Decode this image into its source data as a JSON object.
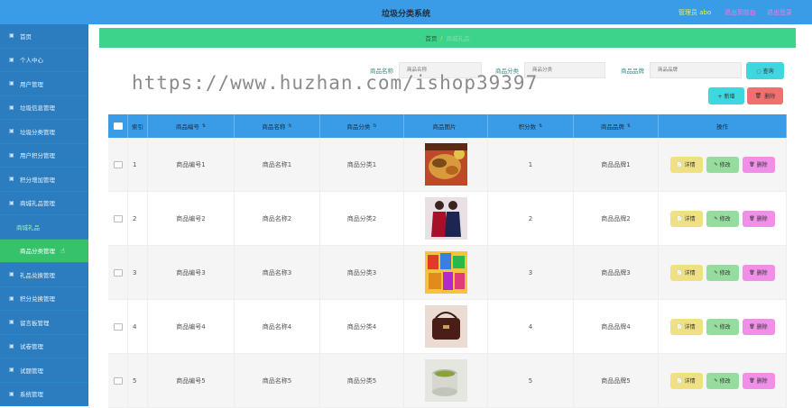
{
  "header": {
    "title": "垃圾分类系统",
    "admin": "管理员 abo",
    "switch": "退出到前台",
    "logout": "退出登录"
  },
  "sidebar": {
    "items": [
      {
        "label": "首页",
        "icon": "home-icon"
      },
      {
        "label": "个人中心",
        "icon": "user-icon"
      },
      {
        "label": "用户管理",
        "icon": "users-icon"
      },
      {
        "label": "垃圾信息管理",
        "icon": "trash-icon"
      },
      {
        "label": "垃圾分类管理",
        "icon": "category-icon"
      },
      {
        "label": "用户积分管理",
        "icon": "points-icon"
      },
      {
        "label": "积分增加管理",
        "icon": "plus-icon"
      },
      {
        "label": "商城礼品管理",
        "icon": "gift-icon"
      },
      {
        "label": "商城礼品",
        "sub": true
      },
      {
        "label": "商品分类管理",
        "sub": true,
        "active": true
      },
      {
        "label": "礼品兑换管理",
        "icon": "exchange-icon"
      },
      {
        "label": "积分兑换管理",
        "icon": "coin-icon"
      },
      {
        "label": "留言板管理",
        "icon": "message-icon"
      },
      {
        "label": "试卷管理",
        "icon": "paper-icon"
      },
      {
        "label": "试题管理",
        "icon": "question-icon"
      },
      {
        "label": "系统管理",
        "icon": "settings-icon"
      }
    ]
  },
  "breadcrumb": {
    "home": "首页",
    "sep": "/",
    "current": "商城礼品"
  },
  "watermark": "https://www.huzhan.com/ishop39397",
  "search": {
    "name_label": "商品名称",
    "name_placeholder": "商品名称",
    "category_label": "商品分类",
    "category_placeholder": "商品分类",
    "brand_label": "商品品牌",
    "brand_placeholder": "商品品牌",
    "query_button": "◌ 查询"
  },
  "toolbar": {
    "add": "+ 新增",
    "delete": "删除"
  },
  "table": {
    "headers": [
      "",
      "索引",
      "商品编号",
      "商品名称",
      "商品分类",
      "商品图片",
      "积分数",
      "商品品牌",
      "操作"
    ],
    "rows": [
      {
        "index": "1",
        "code": "商品编号1",
        "name": "商品名称1",
        "category": "商品分类1",
        "points": "1",
        "brand": "商品品牌1",
        "img": "food"
      },
      {
        "index": "2",
        "code": "商品编号2",
        "name": "商品名称2",
        "category": "商品分类2",
        "points": "2",
        "brand": "商品品牌2",
        "img": "clothes"
      },
      {
        "index": "3",
        "code": "商品编号3",
        "name": "商品名称3",
        "category": "商品分类3",
        "points": "3",
        "brand": "商品品牌3",
        "img": "snacks"
      },
      {
        "index": "4",
        "code": "商品编号4",
        "name": "商品名称4",
        "category": "商品分类4",
        "points": "4",
        "brand": "商品品牌4",
        "img": "bag"
      },
      {
        "index": "5",
        "code": "商品编号5",
        "name": "商品名称5",
        "category": "商品分类5",
        "points": "5",
        "brand": "商品品牌5",
        "img": "tea"
      }
    ],
    "actions": {
      "detail": "详情",
      "edit": "修改",
      "delete": "删除"
    }
  },
  "colors": {
    "header": "#3a9ce6",
    "sidebar": "#2b7dc0",
    "active": "#36c26a",
    "breadcrumb": "#3dd38b"
  }
}
